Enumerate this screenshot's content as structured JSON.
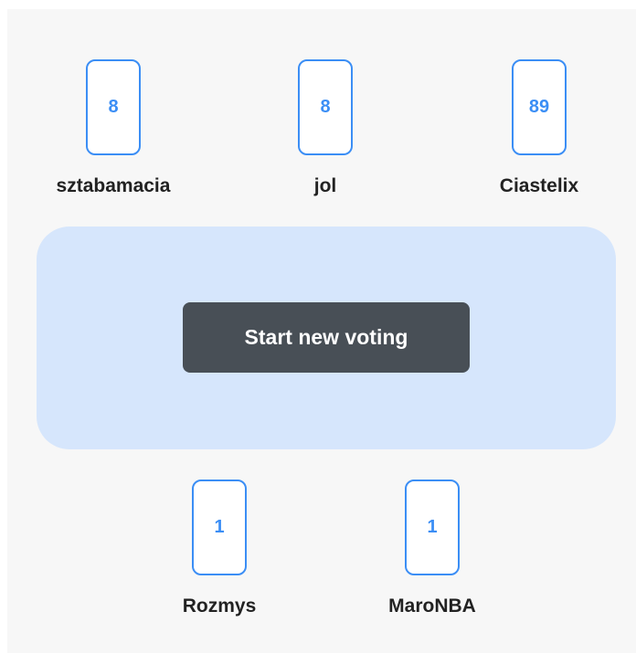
{
  "players_top": [
    {
      "name": "sztabamacia",
      "vote": "8"
    },
    {
      "name": "jol",
      "vote": "8"
    },
    {
      "name": "Ciastelix",
      "vote": "89"
    }
  ],
  "players_bottom": [
    {
      "name": "Rozmys",
      "vote": "1"
    },
    {
      "name": "MaroNBA",
      "vote": "1"
    }
  ],
  "table": {
    "action_label": "Start new voting"
  },
  "colors": {
    "accent": "#3b8ef5",
    "table_background": "#d6e6fc",
    "button_background": "#484f56",
    "page_background": "#f7f7f7"
  }
}
